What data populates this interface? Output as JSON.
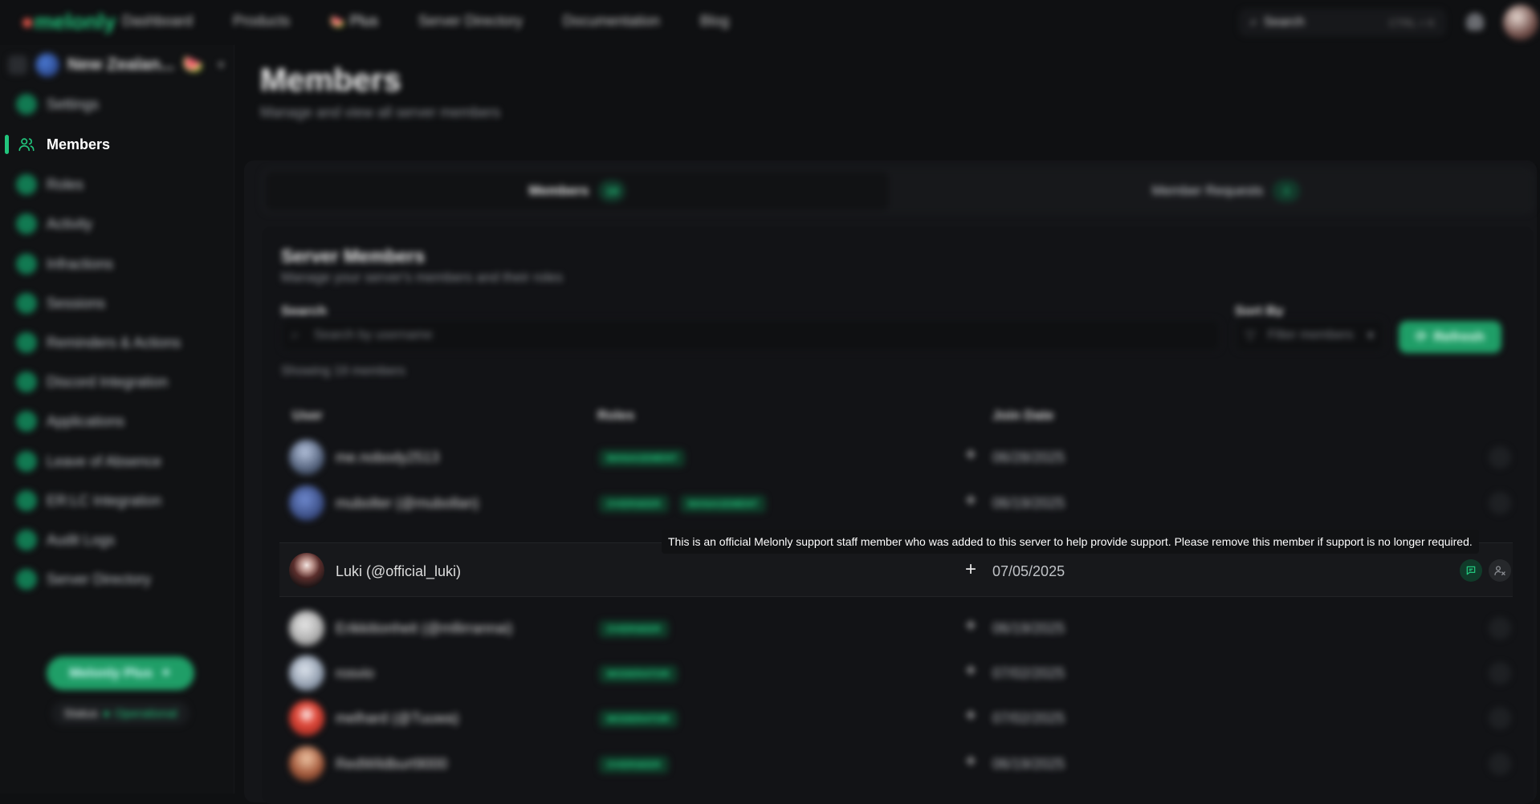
{
  "brand": {
    "logo": "melonly"
  },
  "topnav": {
    "links": [
      "Dashboard",
      "Products",
      "Plus",
      "Server Directory",
      "Documentation",
      "Blog"
    ],
    "search_label": "Search",
    "search_shortcut": "CTRL + K"
  },
  "sidebar": {
    "server_name": "New Zealan...",
    "items": [
      {
        "label": "Settings"
      },
      {
        "label": "Members"
      },
      {
        "label": "Roles"
      },
      {
        "label": "Activity"
      },
      {
        "label": "Infractions"
      },
      {
        "label": "Sessions"
      },
      {
        "label": "Reminders & Actions"
      },
      {
        "label": "Discord Integration"
      },
      {
        "label": "Applications"
      },
      {
        "label": "Leave of Absence"
      },
      {
        "label": "ER:LC Integration"
      },
      {
        "label": "Audit Logs"
      },
      {
        "label": "Server Directory"
      }
    ],
    "premium_button": "Melonly Plus",
    "status_label": "Status",
    "status_value": "Operational"
  },
  "page": {
    "title": "Members",
    "subtitle": "Manage and view all server members"
  },
  "tabs": [
    {
      "label": "Members",
      "count": "19"
    },
    {
      "label": "Member Requests",
      "count": "0"
    }
  ],
  "members_card": {
    "title": "Server Members",
    "subtitle": "Manage your server's members and their roles",
    "search_label": "Search",
    "search_placeholder": "Search by username",
    "sort_label": "Sort By",
    "sort_value": "Filter members",
    "refresh_button": "Refresh",
    "showing_text": "Showing 19 members",
    "columns": [
      "User",
      "Roles",
      "Join Date"
    ]
  },
  "rows": [
    {
      "name": "me.nobody2513",
      "roles": [
        "MANAGEMENT"
      ],
      "date": "06/28/2025"
    },
    {
      "name": "mubolter (@mubollan)",
      "roles": [
        "OVERSEER",
        "MANAGEMENT"
      ],
      "date": "06/19/2025"
    },
    {
      "name": "Luki (@official_luki)",
      "roles": [],
      "date": "07/05/2025"
    },
    {
      "name": "Erikkitionheit (@mllirrannai)",
      "roles": [
        "OVERSEER"
      ],
      "date": "06/19/2025"
    },
    {
      "name": "rosvio",
      "roles": [
        "MODERATOR"
      ],
      "date": "07/02/2025"
    },
    {
      "name": "melhard (@Tuuwa)",
      "roles": [
        "MODERATOR"
      ],
      "date": "07/02/2025"
    },
    {
      "name": "RedWildburt9000",
      "roles": [
        "OVERSEER"
      ],
      "date": "06/19/2025"
    }
  ],
  "tooltip": "This is an official Melonly support staff member who was added to this server to help provide support. Please remove this member if support is no longer required."
}
